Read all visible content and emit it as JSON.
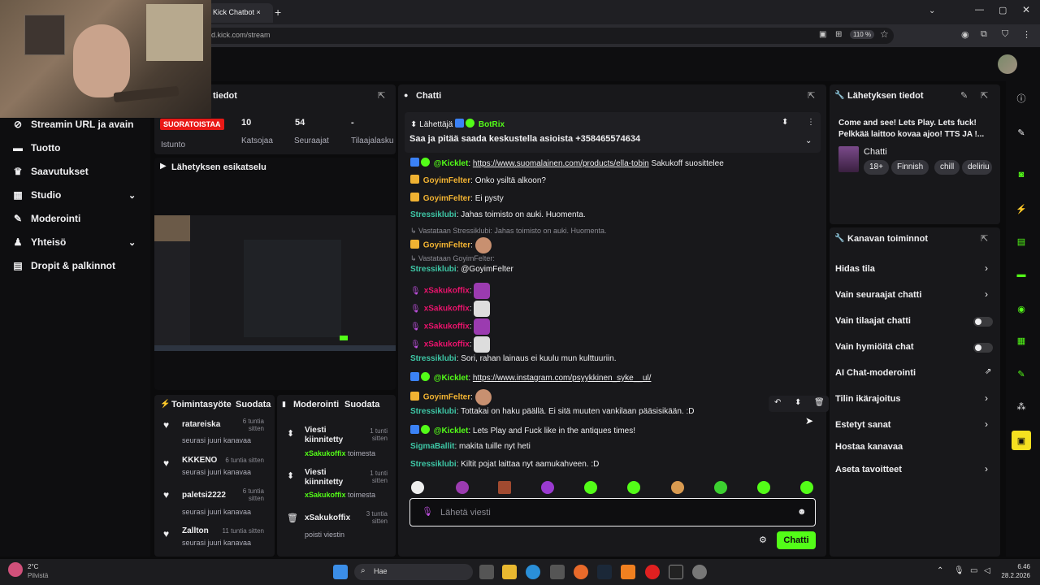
{
  "browser": {
    "tab_title": "Kick Chatbot",
    "url": "rd.kick.com/stream",
    "zoom": "110 %"
  },
  "sidebar": {
    "items": [
      {
        "label": "Streamin URL ja avain",
        "icon": "link-icon"
      },
      {
        "label": "Tuotto",
        "icon": "money-icon"
      },
      {
        "label": "Saavutukset",
        "icon": "trophy-icon"
      },
      {
        "label": "Studio",
        "icon": "studio-icon",
        "expandable": true
      },
      {
        "label": "Moderointi",
        "icon": "wrench-icon"
      },
      {
        "label": "Yhteisö",
        "icon": "community-icon",
        "expandable": true
      },
      {
        "label": "Dropit & palkinnot",
        "icon": "gift-icon"
      }
    ]
  },
  "session": {
    "title": "tiedot",
    "live_badge": "SUORATOISTAA",
    "session_label": "Istunto",
    "viewers_value": "10",
    "viewers_label": "Katsojaa",
    "followers_value": "54",
    "followers_label": "Seuraajat",
    "subs_value": "-",
    "subs_label": "Tilaajalasku"
  },
  "preview": {
    "title": "Lähetyksen esikatselu"
  },
  "activity": {
    "title": "Toimintasyöte",
    "filter": "Suodata",
    "items": [
      {
        "name": "ratareiska",
        "time": "6 tuntia sitten",
        "sub": "seurasi juuri kanavaa"
      },
      {
        "name": "KKKENO",
        "time": "6 tuntia sitten",
        "sub": "seurasi juuri kanavaa"
      },
      {
        "name": "paletsi2222",
        "time": "6 tuntia sitten",
        "sub": "seurasi juuri kanavaa"
      },
      {
        "name": "Zallton",
        "time": "11 tuntia sitten",
        "sub": "seurasi juuri kanavaa"
      }
    ]
  },
  "moderation": {
    "title": "Moderointi",
    "filter": "Suodata",
    "items": [
      {
        "title": "Viesti kiinnitetty",
        "by": "xSakukoffix",
        "suffix": "toimesta",
        "time": "1 tunti sitten",
        "icon": "pin-icon"
      },
      {
        "title": "Viesti kiinnitetty",
        "by": "xSakukoffix",
        "suffix": "toimesta",
        "time": "1 tunti sitten",
        "icon": "pin-icon"
      },
      {
        "title": "xSakukoffix",
        "by": "",
        "suffix": "poisti viestin",
        "time": "3 tuntia sitten",
        "icon": "trash-icon"
      }
    ]
  },
  "chat": {
    "title": "Chatti",
    "pinned_sender_label": "Lähettäjä",
    "pinned_sender": "BotRix",
    "pinned_text": "Saa ja pitää saada keskustella asioista +358465574634",
    "input_placeholder": "Lähetä viesti",
    "send_label": "Chatti",
    "messages": [
      {
        "user": "@Kicklet",
        "cls": "u-green",
        "sep": ": ",
        "text": "https://www.suomalainen.com/products/ella-tobin",
        "link": true,
        "extra": " Sakukoff suosittelee"
      },
      {
        "user": "GoyimFelter",
        "cls": "u-yellow",
        "sep": ": ",
        "text": "Onko ysiltä alkoon?"
      },
      {
        "user": "GoyimFelter",
        "cls": "u-yellow",
        "sep": ": ",
        "text": "Ei pysty"
      },
      {
        "user": "Stressiklubi",
        "cls": "u-teal",
        "sep": ": ",
        "text": "Jahas toimisto on auki. Huomenta."
      },
      {
        "reply": "Vastataan Stressiklubi: Jahas toimisto on auki. Huomenta."
      },
      {
        "user": "GoyimFelter",
        "cls": "u-yellow",
        "sep": ": ",
        "text": ""
      },
      {
        "reply": "Vastataan GoyimFelter:"
      },
      {
        "user": "Stressiklubi",
        "cls": "u-teal",
        "sep": ": ",
        "text": "@GoyimFelter"
      },
      {
        "user": "xSakukoffix",
        "cls": "u-pink",
        "sep": ": ",
        "text": ""
      },
      {
        "user": "xSakukoffix",
        "cls": "u-pink",
        "sep": ": ",
        "text": ""
      },
      {
        "user": "xSakukoffix",
        "cls": "u-pink",
        "sep": ": ",
        "text": ""
      },
      {
        "user": "xSakukoffix",
        "cls": "u-pink",
        "sep": ": ",
        "text": ""
      },
      {
        "user": "Stressiklubi",
        "cls": "u-teal",
        "sep": ": ",
        "text": "Sori, rahan lainaus ei kuulu mun kulttuuriin."
      },
      {
        "user": "@Kicklet",
        "cls": "u-green",
        "sep": ": ",
        "text": "https://www.instagram.com/psyykkinen_syke__ul/",
        "link": true
      },
      {
        "user": "GoyimFelter",
        "cls": "u-yellow",
        "sep": ": ",
        "text": ""
      },
      {
        "user": "Stressiklubi",
        "cls": "u-teal",
        "sep": ": ",
        "text": "Tottakai on haku päällä. Ei sitä muuten vankilaan pääsisikään. :D"
      },
      {
        "user": "@Kicklet",
        "cls": "u-green",
        "sep": ": ",
        "text": "Lets Play and Fuck like in the antiques times!"
      },
      {
        "user": "SigmaBallit",
        "cls": "u-teal",
        "sep": ": ",
        "text": "makita tuille nyt heti"
      },
      {
        "user": "Stressiklubi",
        "cls": "u-teal",
        "sep": ": ",
        "text": "Kiltit pojat laittaa nyt aamukahveen. :D"
      }
    ]
  },
  "stream_info": {
    "title": "Lähetyksen tiedot",
    "stream_title": "Come and see! Lets Play. Lets fuck! Pelkkää laittoo kovaa ajoo! TTS JA !...",
    "category": "Chatti",
    "tags": [
      "18+",
      "Finnish",
      "chill",
      "deliriu"
    ]
  },
  "channel_actions": {
    "title": "Kanavan toiminnot",
    "items": [
      {
        "label": "Hidas tila",
        "type": "chevron"
      },
      {
        "label": "Vain seuraajat chatti",
        "type": "chevron"
      },
      {
        "label": "Vain tilaajat chatti",
        "type": "toggle"
      },
      {
        "label": "Vain hymiöitä chat",
        "type": "toggle"
      },
      {
        "label": "AI Chat-moderointi",
        "type": "external"
      },
      {
        "label": "Tilin ikärajoitus",
        "type": "chevron"
      },
      {
        "label": "Estetyt sanat",
        "type": "chevron"
      },
      {
        "label": "Hostaa kanavaa",
        "type": "none"
      },
      {
        "label": "Aseta tavoitteet",
        "type": "chevron"
      }
    ]
  },
  "taskbar": {
    "weather_temp": "2°C",
    "weather_desc": "Pilvistä",
    "search": "Hae",
    "time": "6.46",
    "date": "28.2.2026"
  },
  "colors": {
    "accent": "#53fc18",
    "live": "#e91916"
  }
}
